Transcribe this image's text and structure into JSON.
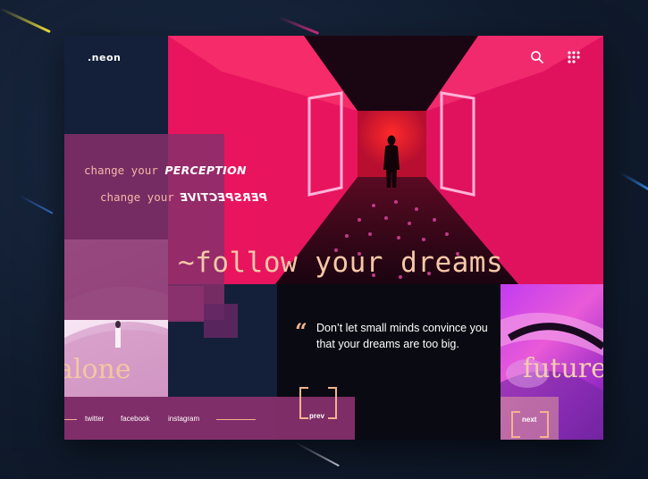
{
  "brand": {
    "logo": ".neon"
  },
  "header": {
    "search_icon": "search-icon",
    "menu_icon": "grid-menu-icon"
  },
  "tagline": {
    "line1_prefix": "change your",
    "line1_emphasis": "PERCEPTION",
    "line2_prefix": "change your",
    "line2_emphasis": "PERSPECTIVE"
  },
  "headline": "~follow your dreams",
  "panels": {
    "left_caption": "alone",
    "right_caption": "future"
  },
  "quote": {
    "mark": "“",
    "text": "Don’t let small minds convince you that your dreams are too big."
  },
  "footer": {
    "social": [
      "twitter",
      "facebook",
      "instagram"
    ]
  },
  "nav": {
    "prev": "prev",
    "next": "next"
  },
  "colors": {
    "accent": "#f5b28f",
    "neon_pink": "#ff2d67",
    "plum": "#862f6b",
    "background": "#14203a"
  }
}
